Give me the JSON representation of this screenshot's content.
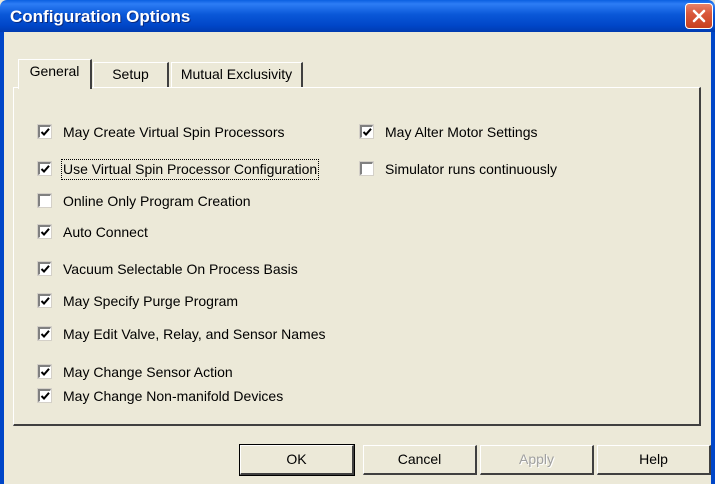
{
  "window": {
    "title": "Configuration Options"
  },
  "tabs": [
    {
      "label": "General",
      "active": true
    },
    {
      "label": "Setup",
      "active": false
    },
    {
      "label": "Mutual Exclusivity",
      "active": false
    }
  ],
  "options": [
    {
      "label": "May Create Virtual Spin Processors",
      "checked": true
    },
    {
      "label": "Use Virtual Spin Processor Configuration",
      "checked": true
    },
    {
      "label": "Online Only Program Creation",
      "checked": false
    },
    {
      "label": "Auto Connect",
      "checked": true
    },
    {
      "label": "Vacuum Selectable On Process Basis",
      "checked": true
    },
    {
      "label": "May Specify Purge Program",
      "checked": true
    },
    {
      "label": "May Edit Valve, Relay, and Sensor Names",
      "checked": true
    },
    {
      "label": "May Change Sensor Action",
      "checked": true
    },
    {
      "label": "May Change Non-manifold Devices",
      "checked": true
    },
    {
      "label": "May Alter Motor Settings",
      "checked": true
    },
    {
      "label": "Simulator runs continuously",
      "checked": false
    }
  ],
  "buttons": {
    "ok": "OK",
    "cancel": "Cancel",
    "apply": "Apply",
    "help": "Help"
  },
  "icons": {
    "close": "close-icon",
    "check": "check-icon"
  }
}
